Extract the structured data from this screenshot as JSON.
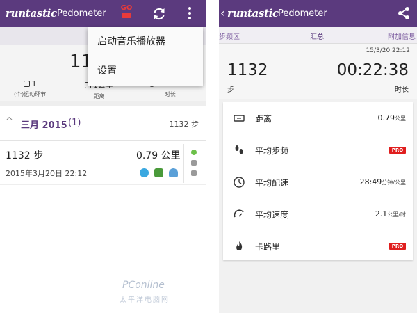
{
  "left_screen": {
    "appbar": {
      "brand": "runtastic",
      "app_name": "Pedometer",
      "go_label": "GO"
    },
    "menu": {
      "items": [
        "启动音乐播放器",
        "设置"
      ]
    },
    "summary": {
      "big_value": "11",
      "stats": [
        {
          "value": "1",
          "label": "(个)运动环节"
        },
        {
          "value": "1公里",
          "label": "距离"
        },
        {
          "value": "00:22:38",
          "label": "时长"
        }
      ]
    },
    "month": {
      "chevron": "^",
      "title": "三月 2015",
      "count": "(1)",
      "steps": "1132 步"
    },
    "session": {
      "steps": "1132 步",
      "distance": "0.79 公里",
      "date": "2015年3月20日 22:12"
    }
  },
  "right_screen": {
    "appbar": {
      "back": "‹",
      "brand": "runtastic",
      "app_name": "Pedometer"
    },
    "tabs": [
      "步频区",
      "汇总",
      "附加信息"
    ],
    "summary": {
      "date": "15/3/20 22:12",
      "steps": "1132",
      "steps_label": "步",
      "time": "00:22:38",
      "time_label": "时长"
    },
    "rows": [
      {
        "icon": "distance-icon",
        "label": "距离",
        "value": "0.79",
        "unit": "公里",
        "pro": false
      },
      {
        "icon": "footsteps-icon",
        "label": "平均步频",
        "value": "",
        "unit": "",
        "pro": true
      },
      {
        "icon": "pace-icon",
        "label": "平均配速",
        "value": "28:49",
        "unit": "分钟/公里",
        "pro": false
      },
      {
        "icon": "speed-icon",
        "label": "平均速度",
        "value": "2.1",
        "unit": "公里/时",
        "pro": false
      },
      {
        "icon": "flame-icon",
        "label": "卡路里",
        "value": "",
        "unit": "",
        "pro": true
      }
    ],
    "pro_label": "PRO"
  },
  "watermark": {
    "line1": "PConline",
    "line2": "太平洋电脑网"
  },
  "colors": {
    "brand_purple": "#5b3a7e",
    "pro_red": "#e01e1e",
    "go_red": "#e83a3a"
  }
}
